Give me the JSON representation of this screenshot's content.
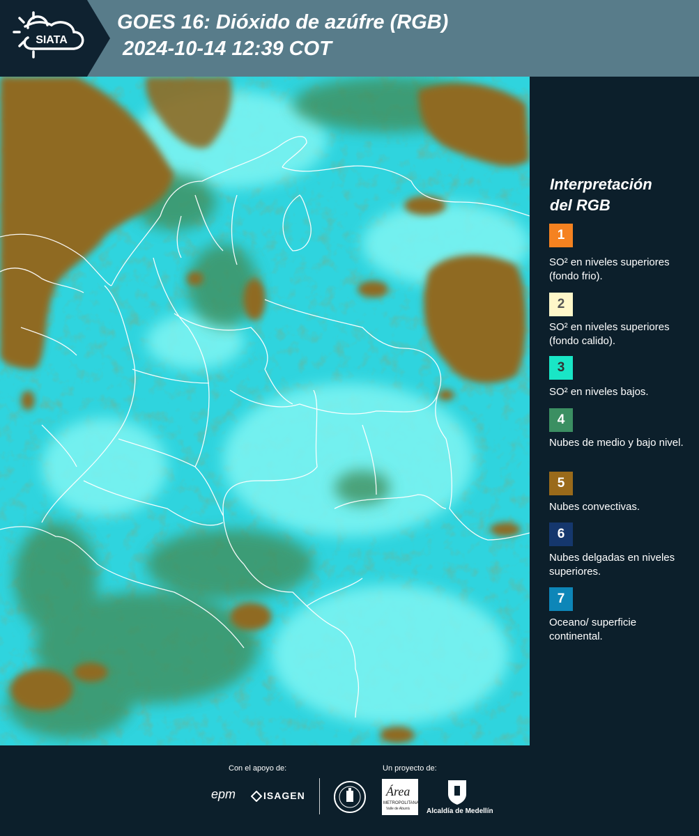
{
  "header": {
    "logo_text": "SIATA",
    "title_line1": "GOES 16: Dióxido de azúfre (RGB)",
    "title_line2": "2024-10-14 12:39 COT"
  },
  "legend": {
    "title_line1": "Interpretación",
    "title_line2": "del RGB",
    "items": [
      {
        "number": "1",
        "color": "#f58220",
        "text_color": "#ffffff",
        "description": "SO² en niveles superiores (fondo frio)."
      },
      {
        "number": "2",
        "color": "#fff7c9",
        "text_color": "#555555",
        "description": "SO² en niveles superiores (fondo calido)."
      },
      {
        "number": "3",
        "color": "#19e6c6",
        "text_color": "#333333",
        "description": "SO² en niveles bajos."
      },
      {
        "number": "4",
        "color": "#3b8f62",
        "text_color": "#ffffff",
        "description": "Nubes de medio y bajo nivel."
      },
      {
        "number": "5",
        "color": "#9a6a1a",
        "text_color": "#ffffff",
        "description": "Nubes convectivas."
      },
      {
        "number": "6",
        "color": "#15376d",
        "text_color": "#ffffff",
        "description": "Nubes delgadas en niveles superiores."
      },
      {
        "number": "7",
        "color": "#0d86b8",
        "text_color": "#ffffff",
        "description": "Oceano/ superficie continental."
      }
    ]
  },
  "footer": {
    "support_label": "Con el apoyo de:",
    "project_label": "Un proyecto de:",
    "sponsors": [
      "epm",
      "ISAGEN"
    ],
    "partners": [
      "Área Metropolitana Valle de Aburrá",
      "Alcaldía de Medellín"
    ],
    "epm_text": "epm",
    "isagen_text": "ISAGEN",
    "area_text": "Área",
    "area_sub1": "METROPOLITANA",
    "area_sub2": "Valle de Aburrá",
    "alcaldia_text": "Alcaldía de Medellín"
  }
}
